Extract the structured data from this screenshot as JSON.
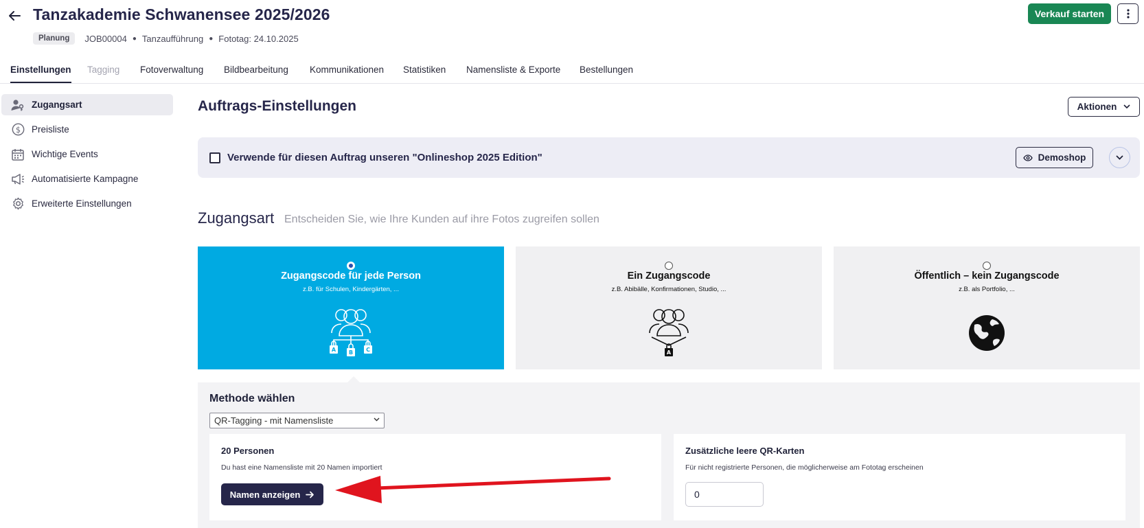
{
  "header": {
    "title": "Tanzakademie Schwanensee 2025/2026",
    "status": "Planung",
    "job_id": "JOB00004",
    "job_type": "Tanzaufführung",
    "photo_day": "Fototag: 24.10.2025",
    "sale_button": "Verkauf starten"
  },
  "tabs": [
    {
      "label": "Einstellungen",
      "state": "active"
    },
    {
      "label": "Tagging",
      "state": "disabled"
    },
    {
      "label": "Fotoverwaltung",
      "state": "normal"
    },
    {
      "label": "Bildbearbeitung",
      "state": "normal"
    },
    {
      "label": "Kommunikationen",
      "state": "normal"
    },
    {
      "label": "Statistiken",
      "state": "normal"
    },
    {
      "label": "Namensliste & Exporte",
      "state": "normal"
    },
    {
      "label": "Bestellungen",
      "state": "normal"
    }
  ],
  "sidebar": {
    "items": [
      {
        "label": "Zugangsart",
        "icon": "user-key-icon",
        "active": true
      },
      {
        "label": "Preisliste",
        "icon": "dollar-circle-icon",
        "active": false
      },
      {
        "label": "Wichtige Events",
        "icon": "calendar-icon",
        "active": false
      },
      {
        "label": "Automatisierte Kampagne",
        "icon": "megaphone-icon",
        "active": false
      },
      {
        "label": "Erweiterte Einstellungen",
        "icon": "gear-icon",
        "active": false
      }
    ]
  },
  "main": {
    "title": "Auftrags-Einstellungen",
    "actions_button": "Aktionen",
    "shop_banner": {
      "label": "Verwende für diesen Auftrag unseren \"Onlineshop 2025 Edition\"",
      "checked": false,
      "demoshop_button": "Demoshop"
    },
    "access": {
      "title": "Zugangsart",
      "subtitle": "Entscheiden Sie, wie Ihre Kunden auf ihre Fotos zugreifen sollen",
      "options": [
        {
          "title": "Zugangscode für jede Person",
          "sub": "z.B. für Schulen, Kindergärten, ...",
          "selected": true,
          "icon": "group-locks-abc-icon"
        },
        {
          "title": "Ein Zugangscode",
          "sub": "z.B. Abibälle, Konfirmationen, Studio, ...",
          "selected": false,
          "icon": "group-single-lock-icon"
        },
        {
          "title": "Öffentlich – kein Zugangscode",
          "sub": "z.B. als Portfolio, ...",
          "selected": false,
          "icon": "globe-icon"
        }
      ],
      "lock_letters": [
        "A",
        "B",
        "C"
      ]
    },
    "method": {
      "title": "Methode wählen",
      "selected": "QR-Tagging - mit Namensliste",
      "persons_card": {
        "title": "20 Personen",
        "desc": "Du hast eine Namensliste mit 20 Namen importiert",
        "button": "Namen anzeigen"
      },
      "qr_card": {
        "title": "Zusätzliche leere QR-Karten",
        "desc": "Für nicht registrierte Personen, die möglicherweise am Fototag erscheinen",
        "value": "0"
      }
    }
  },
  "colors": {
    "accent_selected": "#00aae2",
    "sale_green": "#198754",
    "dark_navy": "#26264a",
    "annotation_arrow": "#e0141e"
  }
}
